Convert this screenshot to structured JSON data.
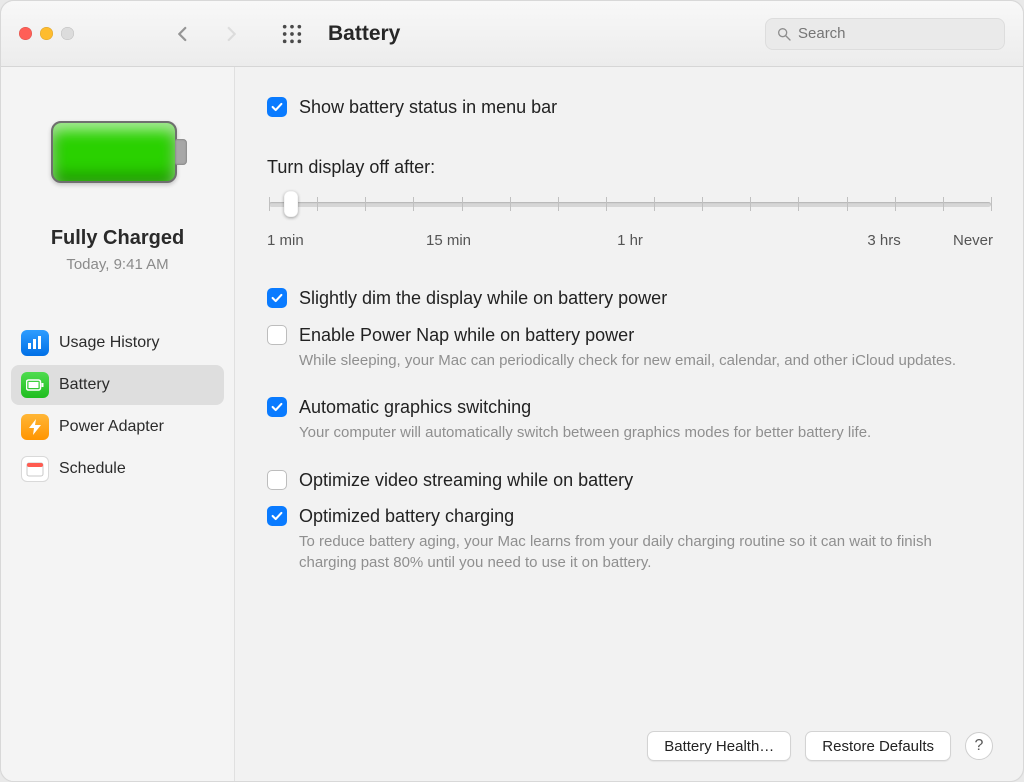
{
  "window": {
    "title": "Battery"
  },
  "search": {
    "placeholder": "Search"
  },
  "hero": {
    "status": "Fully Charged",
    "timestamp": "Today, 9:41 AM"
  },
  "sidebar": {
    "items": [
      {
        "label": "Usage History",
        "icon": "bars-icon",
        "color": "blue"
      },
      {
        "label": "Battery",
        "icon": "battery-icon",
        "color": "green",
        "selected": true
      },
      {
        "label": "Power Adapter",
        "icon": "bolt-icon",
        "color": "orange"
      },
      {
        "label": "Schedule",
        "icon": "calendar-icon",
        "color": "white"
      }
    ]
  },
  "options": {
    "show_status": {
      "label": "Show battery status in menu bar",
      "checked": true
    },
    "dim": {
      "label": "Slightly dim the display while on battery power",
      "checked": true
    },
    "powernap": {
      "label": "Enable Power Nap while on battery power",
      "desc": "While sleeping, your Mac can periodically check for new email, calendar, and other iCloud updates.",
      "checked": false
    },
    "graphics": {
      "label": "Automatic graphics switching",
      "desc": "Your computer will automatically switch between graphics modes for better battery life.",
      "checked": true
    },
    "streaming": {
      "label": "Optimize video streaming while on battery",
      "checked": false
    },
    "optimized": {
      "label": "Optimized battery charging",
      "desc": "To reduce battery aging, your Mac learns from your daily charging routine so it can wait to finish charging past 80% until you need to use it on battery.",
      "checked": true
    }
  },
  "slider": {
    "label": "Turn display off after:",
    "ticks": [
      "1 min",
      "15 min",
      "1 hr",
      "3 hrs",
      "Never"
    ],
    "tick_positions_pct": [
      0,
      25,
      50,
      85,
      100
    ],
    "minor_tick_count": 15,
    "value_pct": 3
  },
  "footer": {
    "battery_health": "Battery Health…",
    "restore_defaults": "Restore Defaults",
    "help": "?"
  }
}
